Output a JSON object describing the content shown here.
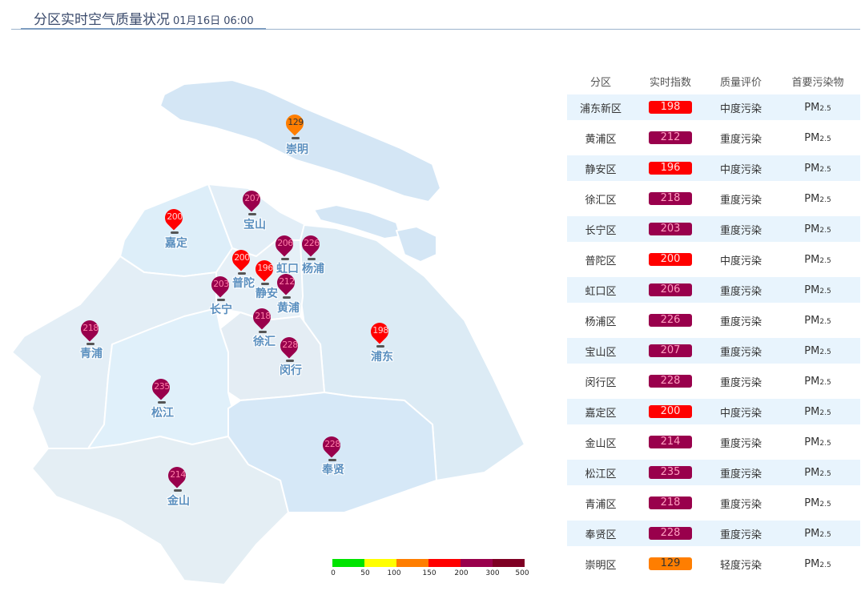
{
  "header": {
    "title": "分区实时空气质量状况",
    "time": "01月16日 06:00"
  },
  "colors": {
    "good": "#00e400",
    "moderate": "#ffff00",
    "light": "#ff7e00",
    "medium": "#ff0000",
    "heavy": "#99004c",
    "severe": "#7e0023",
    "label": "#5a8fbf",
    "row_alt": "#e8f4fd"
  },
  "legend": {
    "colors": [
      "#00e400",
      "#ffff00",
      "#ff7e00",
      "#ff0000",
      "#99004c",
      "#7e0023"
    ],
    "ticks": [
      "0",
      "50",
      "100",
      "150",
      "200",
      "300",
      "500"
    ]
  },
  "markers": [
    {
      "name": "崇明",
      "value": "129",
      "level": "light"
    },
    {
      "name": "嘉定",
      "value": "200",
      "level": "medium"
    },
    {
      "name": "宝山",
      "value": "207",
      "level": "heavy"
    },
    {
      "name": "普陀",
      "value": "200",
      "level": "medium"
    },
    {
      "name": "虹口",
      "value": "206",
      "level": "heavy"
    },
    {
      "name": "杨浦",
      "value": "226",
      "level": "heavy"
    },
    {
      "name": "静安",
      "value": "196",
      "level": "medium"
    },
    {
      "name": "黄浦",
      "value": "212",
      "level": "heavy"
    },
    {
      "name": "长宁",
      "value": "203",
      "level": "heavy"
    },
    {
      "name": "徐汇",
      "value": "218",
      "level": "heavy"
    },
    {
      "name": "闵行",
      "value": "228",
      "level": "heavy"
    },
    {
      "name": "浦东",
      "value": "198",
      "level": "medium"
    },
    {
      "name": "青浦",
      "value": "218",
      "level": "heavy"
    },
    {
      "name": "松江",
      "value": "235",
      "level": "heavy"
    },
    {
      "name": "奉贤",
      "value": "228",
      "level": "heavy"
    },
    {
      "name": "金山",
      "value": "214",
      "level": "heavy"
    }
  ],
  "table": {
    "headers": [
      "分区",
      "实时指数",
      "质量评价",
      "首要污染物"
    ],
    "pollutant": {
      "main": "PM",
      "sub": "2.5"
    },
    "rows": [
      {
        "district": "浦东新区",
        "aqi": "198",
        "quality": "中度污染",
        "level": "medium"
      },
      {
        "district": "黄浦区",
        "aqi": "212",
        "quality": "重度污染",
        "level": "heavy"
      },
      {
        "district": "静安区",
        "aqi": "196",
        "quality": "中度污染",
        "level": "medium"
      },
      {
        "district": "徐汇区",
        "aqi": "218",
        "quality": "重度污染",
        "level": "heavy"
      },
      {
        "district": "长宁区",
        "aqi": "203",
        "quality": "重度污染",
        "level": "heavy"
      },
      {
        "district": "普陀区",
        "aqi": "200",
        "quality": "中度污染",
        "level": "medium"
      },
      {
        "district": "虹口区",
        "aqi": "206",
        "quality": "重度污染",
        "level": "heavy"
      },
      {
        "district": "杨浦区",
        "aqi": "226",
        "quality": "重度污染",
        "level": "heavy"
      },
      {
        "district": "宝山区",
        "aqi": "207",
        "quality": "重度污染",
        "level": "heavy"
      },
      {
        "district": "闵行区",
        "aqi": "228",
        "quality": "重度污染",
        "level": "heavy"
      },
      {
        "district": "嘉定区",
        "aqi": "200",
        "quality": "中度污染",
        "level": "medium"
      },
      {
        "district": "金山区",
        "aqi": "214",
        "quality": "重度污染",
        "level": "heavy"
      },
      {
        "district": "松江区",
        "aqi": "235",
        "quality": "重度污染",
        "level": "heavy"
      },
      {
        "district": "青浦区",
        "aqi": "218",
        "quality": "重度污染",
        "level": "heavy"
      },
      {
        "district": "奉贤区",
        "aqi": "228",
        "quality": "重度污染",
        "level": "heavy"
      },
      {
        "district": "崇明区",
        "aqi": "129",
        "quality": "轻度污染",
        "level": "light"
      }
    ]
  }
}
